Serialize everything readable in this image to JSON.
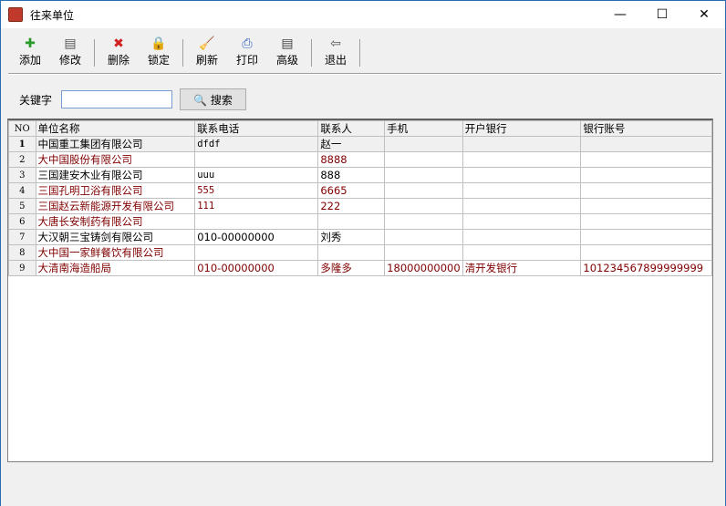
{
  "window": {
    "title": "往来单位",
    "minimize": "—",
    "maximize": "☐",
    "close": "✕"
  },
  "toolbar": [
    {
      "label": "添加",
      "icon": "add-icon",
      "glyph": "✚",
      "color": "#2a9a2a"
    },
    {
      "label": "修改",
      "icon": "edit-icon",
      "glyph": "▤",
      "color": "#555"
    },
    {
      "label": "删除",
      "icon": "delete-icon",
      "glyph": "✖",
      "color": "#d02020"
    },
    {
      "label": "锁定",
      "icon": "lock-icon",
      "glyph": "🔒",
      "color": "#444"
    },
    {
      "label": "刷新",
      "icon": "broom-icon",
      "glyph": "🧹",
      "color": "#3060c0"
    },
    {
      "label": "打印",
      "icon": "printer-icon",
      "glyph": "⎙",
      "color": "#3060c0"
    },
    {
      "label": "高级",
      "icon": "document-icon",
      "glyph": "▤",
      "color": "#444"
    },
    {
      "label": "退出",
      "icon": "exit-door-icon",
      "glyph": "⇦",
      "color": "#555"
    }
  ],
  "search": {
    "label": "关键字",
    "value": "",
    "button": "搜索",
    "icon": "magnifier-icon"
  },
  "table": {
    "columns": [
      "NO",
      "单位名称",
      "联系电话",
      "联系人",
      "手机",
      "开户银行",
      "银行账号"
    ],
    "rows": [
      {
        "no": "1",
        "name": "中国重工集团有限公司",
        "phone": "dfdf",
        "contact": "赵一",
        "mobile": "",
        "bank": "",
        "account": "",
        "color": "black",
        "selected": true
      },
      {
        "no": "2",
        "name": "大中国股份有限公司",
        "phone": "",
        "contact": "8888",
        "mobile": "",
        "bank": "",
        "account": "",
        "color": "#800000"
      },
      {
        "no": "3",
        "name": "三国建安木业有限公司",
        "phone": "uuu",
        "contact": "888",
        "mobile": "",
        "bank": "",
        "account": "",
        "color": "black"
      },
      {
        "no": "4",
        "name": "三国孔明卫浴有限公司",
        "phone": "555",
        "contact": "6665",
        "mobile": "",
        "bank": "",
        "account": "",
        "color": "#800000"
      },
      {
        "no": "5",
        "name": "三国赵云新能源开发有限公司",
        "phone": "111",
        "contact": "222",
        "mobile": "",
        "bank": "",
        "account": "",
        "color": "#800000"
      },
      {
        "no": "6",
        "name": "大唐长安制药有限公司",
        "phone": "",
        "contact": "",
        "mobile": "",
        "bank": "",
        "account": "",
        "color": "#800000"
      },
      {
        "no": "7",
        "name": "大汉朝三宝铸剑有限公司",
        "phone": "010-00000000",
        "contact": "刘秀",
        "mobile": "",
        "bank": "",
        "account": "",
        "color": "black"
      },
      {
        "no": "8",
        "name": "大中国一家鲜餐饮有限公司",
        "phone": "",
        "contact": "",
        "mobile": "",
        "bank": "",
        "account": "",
        "color": "#800000"
      },
      {
        "no": "9",
        "name": "大清南海造船局",
        "phone": "010-00000000",
        "contact": "多隆多",
        "mobile": "18000000000",
        "bank": "清开发银行",
        "account": "101234567899999999",
        "color": "#800000"
      }
    ]
  }
}
